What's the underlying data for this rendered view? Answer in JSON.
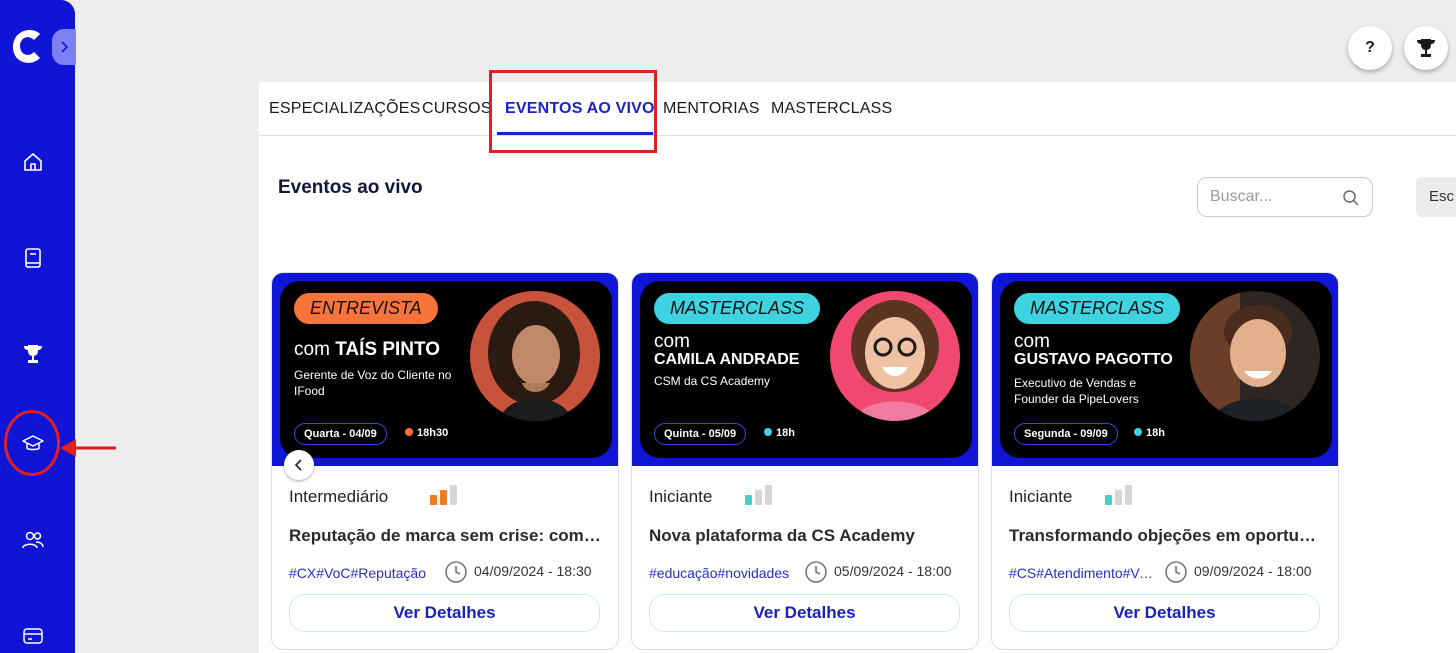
{
  "sidebar": {
    "logo": "c-logo-icon",
    "items": [
      {
        "name": "home-icon"
      },
      {
        "name": "book-icon"
      },
      {
        "name": "trophy-icon"
      },
      {
        "name": "graduation-cap-icon"
      },
      {
        "name": "users-icon"
      },
      {
        "name": "card-icon"
      }
    ],
    "accent_color": "#1014d6"
  },
  "header": {
    "help_label": "?",
    "trophy_icon": "trophy-icon"
  },
  "tabs": [
    {
      "label": "ESPECIALIZAÇÕES",
      "active": false
    },
    {
      "label": "CURSOS",
      "active": false
    },
    {
      "label": "EVENTOS AO VIVO",
      "active": true
    },
    {
      "label": "MENTORIAS",
      "active": false
    },
    {
      "label": "MASTERCLASS",
      "active": false
    }
  ],
  "main": {
    "title": "Eventos ao vivo",
    "search_placeholder": "Buscar...",
    "sort_label": "Esc"
  },
  "cards": [
    {
      "banner": {
        "pill": "ENTREVISTA",
        "pill_color": "#f9743a",
        "com": "com ",
        "name_inline": "TAÍS PINTO",
        "description": "Gerente de Voz do Cliente no IFood",
        "date": "Quarta - 04/09",
        "time": "18h30",
        "dot_color": "#f9743a"
      },
      "level": "Intermediário",
      "level_color": "#f07a1f",
      "level_fill": 2,
      "title": "Reputação de marca sem crise: como gerenciar reclamações",
      "tags": "#CX#VoC#Reputação",
      "datetime": "04/09/2024 - 18:30",
      "button": "Ver Detalhes"
    },
    {
      "banner": {
        "pill": "MASTERCLASS",
        "pill_color": "#3ed3e1",
        "com": "com",
        "name": "CAMILA ANDRADE",
        "description": "CSM da CS Academy",
        "date": "Quinta - 05/09",
        "time": "18h",
        "dot_color": "#3ed3e1"
      },
      "level": "Iniciante",
      "level_color": "#3ed3c6",
      "level_fill": 1,
      "title": "Nova plataforma da CS Academy",
      "tags": "#educação#novidades",
      "datetime": "05/09/2024 - 18:00",
      "button": "Ver Detalhes"
    },
    {
      "banner": {
        "pill": "MASTERCLASS",
        "pill_color": "#3ed3e1",
        "com": "com",
        "name": "GUSTAVO PAGOTTO",
        "description": "Executivo de Vendas e Founder da PipeLovers",
        "date": "Segunda - 09/09",
        "time": "18h",
        "dot_color": "#3ed3e1"
      },
      "level": "Iniciante",
      "level_color": "#3ed3c6",
      "level_fill": 1,
      "title": "Transformando objeções em oportunidades",
      "tags": "#CS#Atendimento#Vendas",
      "datetime": "09/09/2024 - 18:00",
      "button": "Ver Detalhes"
    }
  ]
}
